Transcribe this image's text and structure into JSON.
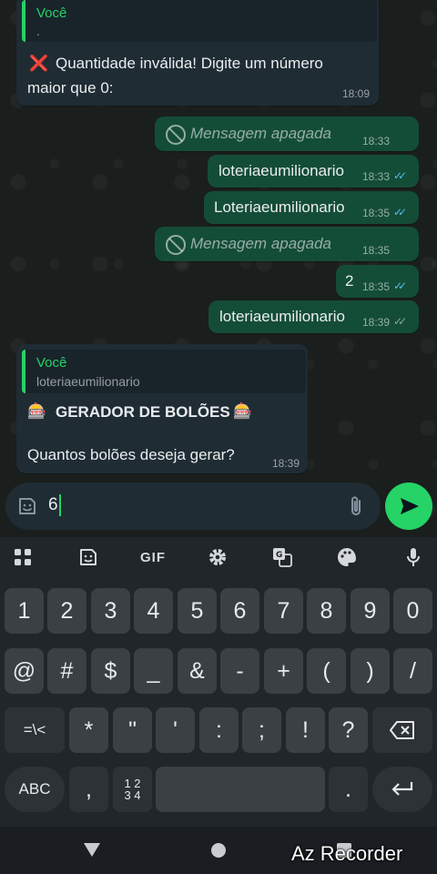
{
  "messages": {
    "m1": {
      "quote_name": "Você",
      "quote_text": ".",
      "text_icon": "❌",
      "text_line1": "Quantidade inválida! Digite um número",
      "text_line2": "maior que 0:",
      "time": "18:09"
    },
    "m2": {
      "text": "Mensagem apagada",
      "time": "18:33"
    },
    "m3": {
      "text": "loteriaeumilionario",
      "time": "18:33"
    },
    "m4": {
      "text": "Loteriaeumilionario",
      "time": "18:35"
    },
    "m5": {
      "text": "Mensagem apagada",
      "time": "18:35"
    },
    "m6": {
      "text": "2",
      "time": "18:35"
    },
    "m7": {
      "text": "loteriaeumilionario",
      "time": "18:39"
    },
    "m8": {
      "quote_name": "Você",
      "quote_text": "loteriaeumilionario",
      "emoji": "🎰",
      "title": "GERADOR DE BOLÕES",
      "body": "Quantos bolões deseja gerar?",
      "time": "18:39"
    }
  },
  "input": {
    "value": "6"
  },
  "toolbar": {
    "gif": "GIF"
  },
  "keyboard": {
    "row1": [
      "1",
      "2",
      "3",
      "4",
      "5",
      "6",
      "7",
      "8",
      "9",
      "0"
    ],
    "row2": [
      "@",
      "#",
      "$",
      "_",
      "&",
      "-",
      "+",
      "(",
      ")",
      "/"
    ],
    "row3": [
      "=\\<",
      "*",
      "\"",
      "'",
      ":",
      ";",
      "!",
      "?"
    ],
    "abc": "ABC",
    "comma": ",",
    "nums_top": "1 2",
    "nums_bottom": "3 4",
    "period": "."
  },
  "watermark": "Az Recorder",
  "colors": {
    "accent": "#25d366",
    "outgoing": "#144d37",
    "incoming": "#1f2c34",
    "read_ticks": "#53bdeb"
  },
  "icons": [
    "emoji-icon",
    "attach-icon",
    "send-icon",
    "apps-icon",
    "sticker-icon",
    "settings-icon",
    "translate-icon",
    "palette-icon",
    "mic-icon",
    "backspace-icon",
    "enter-icon",
    "back-icon",
    "home-icon",
    "recents-icon"
  ]
}
